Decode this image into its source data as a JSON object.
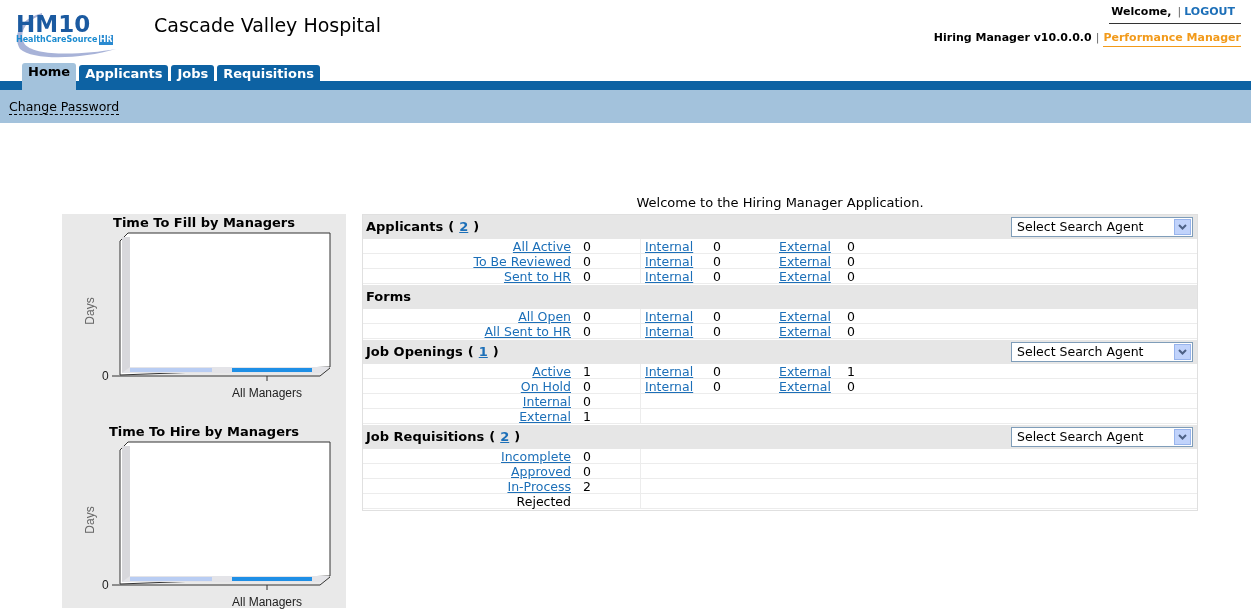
{
  "header": {
    "logo": {
      "main": "HM10",
      "sub": "HealthCareSource",
      "badge": "HR"
    },
    "title": "Cascade Valley Hospital",
    "welcome": "Welcome,",
    "separator": "|",
    "logout": "LOGOUT",
    "version": "Hiring Manager v10.0.0.0",
    "version_separator": "|",
    "performance_link": "Performance Manager"
  },
  "tabs": [
    {
      "label": "Home",
      "selected": true
    },
    {
      "label": "Applicants",
      "selected": false
    },
    {
      "label": "Jobs",
      "selected": false
    },
    {
      "label": "Requisitions",
      "selected": false
    }
  ],
  "subnav": [
    "Change Password"
  ],
  "welcome_message": "Welcome to the Hiring Manager Application.",
  "charts": [
    {
      "title": "Time To Fill by Managers",
      "ylabel": "Days",
      "ytick": "0",
      "category": "All Managers"
    },
    {
      "title": "Time To Hire by Managers",
      "ylabel": "Days",
      "ytick": "0",
      "category": "All Managers"
    }
  ],
  "sections": [
    {
      "title": "Applicants",
      "count_open": "(",
      "count": "2",
      "count_close": ")",
      "search_agent": "Select Search Agent",
      "rows": [
        {
          "label": "All Active",
          "kind": "link",
          "value": "0",
          "internal": "Internal",
          "internal_value": "0",
          "external": "External",
          "external_value": "0"
        },
        {
          "label": "To Be Reviewed",
          "kind": "link",
          "value": "0",
          "internal": "Internal",
          "internal_value": "0",
          "external": "External",
          "external_value": "0"
        },
        {
          "label": "Sent to HR",
          "kind": "link",
          "value": "0",
          "internal": "Internal",
          "internal_value": "0",
          "external": "External",
          "external_value": "0"
        }
      ]
    },
    {
      "title": "Forms",
      "rows": [
        {
          "label": "All Open",
          "kind": "link",
          "value": "0",
          "internal": "Internal",
          "internal_value": "0",
          "external": "External",
          "external_value": "0"
        },
        {
          "label": "All Sent to HR",
          "kind": "link",
          "value": "0",
          "internal": "Internal",
          "internal_value": "0",
          "external": "External",
          "external_value": "0"
        }
      ]
    },
    {
      "title": "Job Openings",
      "count_open": "(",
      "count": "1",
      "count_close": ")",
      "search_agent": "Select Search Agent",
      "rows": [
        {
          "label": "Active",
          "kind": "link",
          "value": "1",
          "internal": "Internal",
          "internal_value": "0",
          "external": "External",
          "external_value": "1"
        },
        {
          "label": "On Hold",
          "kind": "link",
          "value": "0",
          "internal": "Internal",
          "internal_value": "0",
          "external": "External",
          "external_value": "0"
        },
        {
          "label": "Internal",
          "kind": "link",
          "value": "0"
        },
        {
          "label": "External",
          "kind": "link",
          "value": "1"
        }
      ]
    },
    {
      "title": "Job Requisitions",
      "count_open": "(",
      "count": "2",
      "count_close": ")",
      "search_agent": "Select Search Agent",
      "rows": [
        {
          "label": "Incomplete",
          "kind": "link",
          "value": "0"
        },
        {
          "label": "Approved",
          "kind": "link",
          "value": "0"
        },
        {
          "label": "In-Process",
          "kind": "link",
          "value": "2"
        },
        {
          "label": "Rejected",
          "kind": "text"
        }
      ]
    }
  ]
}
